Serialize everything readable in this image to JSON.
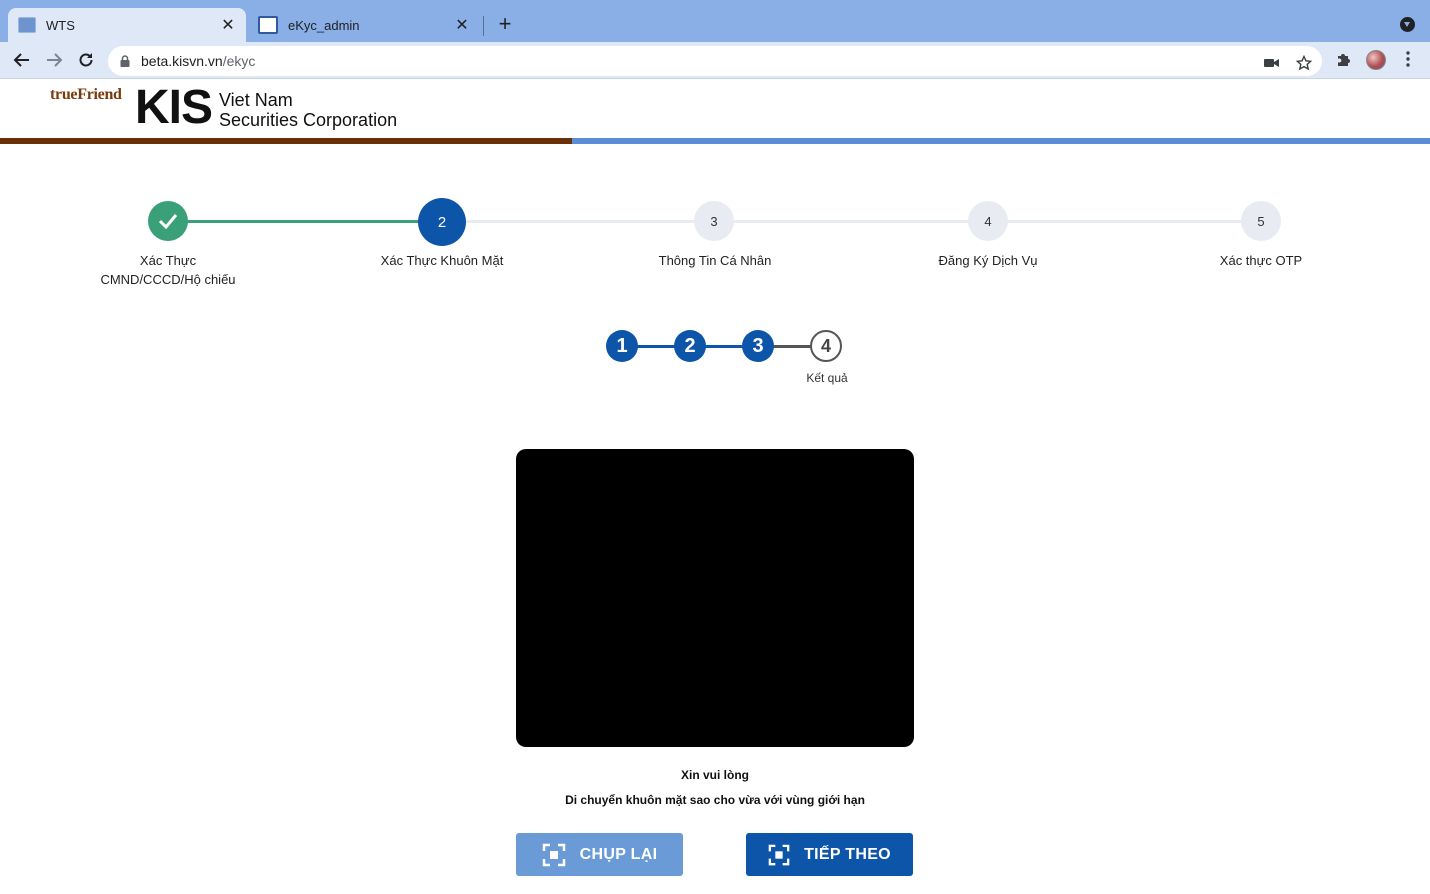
{
  "browser": {
    "tabs": [
      {
        "title": "WTS",
        "active": true
      },
      {
        "title": "eKyc_admin",
        "active": false
      }
    ],
    "url_host": "beta.kisvn.vn",
    "url_path": "/ekyc"
  },
  "header": {
    "logo_truefriend": "trueFriend",
    "logo_kis": "KIS",
    "logo_line1": "Viet Nam",
    "logo_line2": "Securities Corporation",
    "progress_fraction": 0.4
  },
  "steps": [
    {
      "number": "✓",
      "label": "Xác Thực",
      "label2": "CMND/CCCD/Hộ chiếu",
      "state": "done"
    },
    {
      "number": "2",
      "label": "Xác Thực Khuôn Mặt",
      "label2": "",
      "state": "active"
    },
    {
      "number": "3",
      "label": "Thông Tin Cá Nhân",
      "label2": "",
      "state": "pending"
    },
    {
      "number": "4",
      "label": "Đăng Ký Dịch Vụ",
      "label2": "",
      "state": "pending"
    },
    {
      "number": "5",
      "label": "Xác thực OTP",
      "label2": "",
      "state": "pending"
    }
  ],
  "substeps": {
    "nodes": [
      "1",
      "2",
      "3",
      "4"
    ],
    "last_label": "Kết quả"
  },
  "instructions": {
    "line1": "Xin vui lòng",
    "line2": "Di chuyển khuôn mặt sao cho vừa với vùng giới hạn"
  },
  "buttons": {
    "retake": "CHỤP LẠI",
    "next": "TIẾP THEO"
  },
  "colors": {
    "done": "#3aa07a",
    "active": "#0d55a8",
    "pending": "#e8ebf1",
    "brand_brown": "#6a3107"
  }
}
